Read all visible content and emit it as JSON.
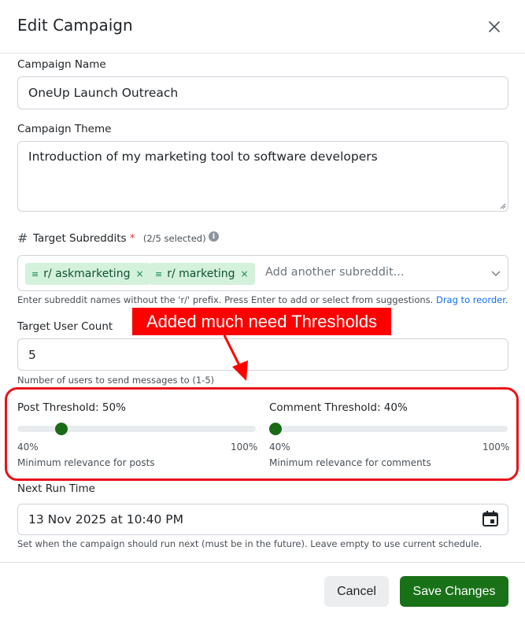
{
  "modal": {
    "title": "Edit Campaign"
  },
  "name": {
    "label": "Campaign Name",
    "value": "OneUp Launch Outreach"
  },
  "theme": {
    "label": "Campaign Theme",
    "value": "Introduction of my marketing tool to software developers"
  },
  "subreddits": {
    "hash": "#",
    "label": "Target Subreddits",
    "required_mark": "*",
    "count": "(2/5 selected)",
    "chips": [
      {
        "label": "r/ askmarketing",
        "grip": "≡",
        "remove": "×"
      },
      {
        "label": "r/ marketing",
        "grip": "≡",
        "remove": "×"
      }
    ],
    "placeholder": "Add another subreddit...",
    "help": "Enter subreddit names without the 'r/' prefix. Press Enter to add or select from suggestions.",
    "drag_hint": "Drag to reorder."
  },
  "target_users": {
    "label": "Target User Count",
    "value": "5",
    "help": "Number of users to send messages to (1-5)"
  },
  "annotation": {
    "text": "Added much need Thresholds",
    "color": "#ff0000"
  },
  "post_threshold": {
    "label": "Post Threshold: 50%",
    "value": 0.5,
    "min_label": "40%",
    "max_label": "100%",
    "help": "Minimum relevance for posts"
  },
  "comment_threshold": {
    "label": "Comment Threshold: 40%",
    "value": 0.4,
    "min_label": "40%",
    "max_label": "100%",
    "help": "Minimum relevance for comments"
  },
  "next_run": {
    "label": "Next Run Time",
    "value": "13 Nov 2025 at 10:40 PM",
    "help": "Set when the campaign should run next (must be in the future). Leave empty to use current schedule.",
    "icon": "calendar-icon"
  },
  "footer": {
    "cancel_label": "Cancel",
    "save_label": "Save Changes"
  },
  "colors": {
    "accent": "#197118",
    "chip_bg": "#d4f1dc",
    "highlight": "#e8131b"
  }
}
